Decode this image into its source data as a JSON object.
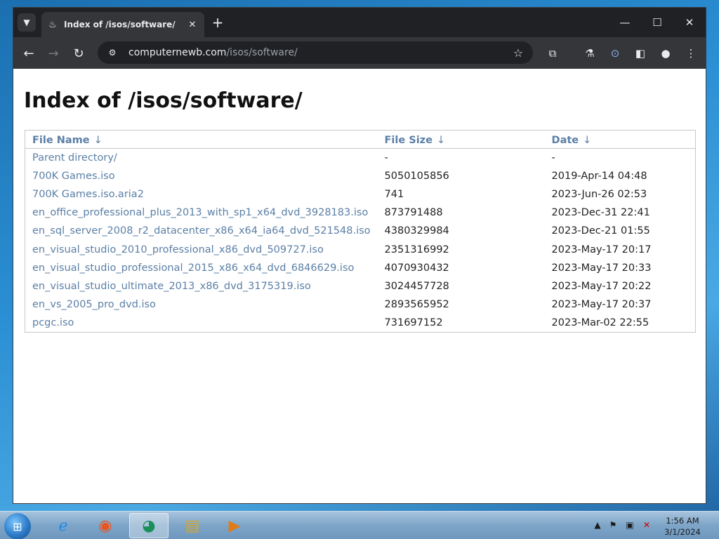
{
  "browser": {
    "tab_title": "Index of /isos/software/",
    "url_host": "computernewb.com",
    "url_path": "/isos/software/"
  },
  "page": {
    "heading": "Index of /isos/software/",
    "columns": {
      "name": "File Name",
      "size": "File Size",
      "date": "Date",
      "sort_arrow": "↓"
    },
    "rows": [
      {
        "name": "Parent directory/",
        "size": "-",
        "date": "-"
      },
      {
        "name": "700K Games.iso",
        "size": "5050105856",
        "date": "2019-Apr-14 04:48"
      },
      {
        "name": "700K Games.iso.aria2",
        "size": "741",
        "date": "2023-Jun-26 02:53"
      },
      {
        "name": "en_office_professional_plus_2013_with_sp1_x64_dvd_3928183.iso",
        "size": "873791488",
        "date": "2023-Dec-31 22:41"
      },
      {
        "name": "en_sql_server_2008_r2_datacenter_x86_x64_ia64_dvd_521548.iso",
        "size": "4380329984",
        "date": "2023-Dec-21 01:55"
      },
      {
        "name": "en_visual_studio_2010_professional_x86_dvd_509727.iso",
        "size": "2351316992",
        "date": "2023-May-17 20:17"
      },
      {
        "name": "en_visual_studio_professional_2015_x86_x64_dvd_6846629.iso",
        "size": "4070930432",
        "date": "2023-May-17 20:33"
      },
      {
        "name": "en_visual_studio_ultimate_2013_x86_dvd_3175319.iso",
        "size": "3024457728",
        "date": "2023-May-17 20:22"
      },
      {
        "name": "en_vs_2005_pro_dvd.iso",
        "size": "2893565952",
        "date": "2023-May-17 20:37"
      },
      {
        "name": "pcgc.iso",
        "size": "731697152",
        "date": "2023-Mar-02 22:55"
      }
    ]
  },
  "taskbar": {
    "time": "1:56 AM",
    "date": "3/1/2024"
  }
}
